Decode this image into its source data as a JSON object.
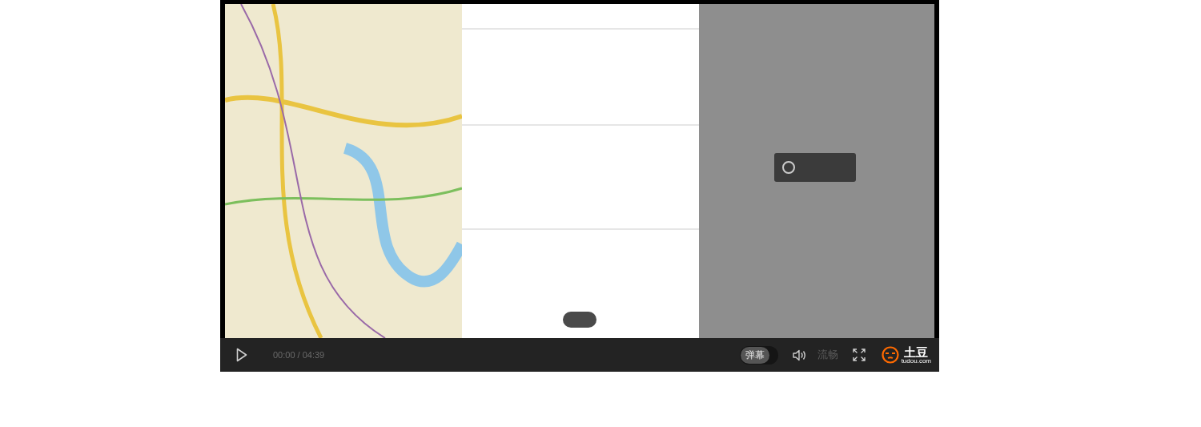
{
  "controls": {
    "time": "00:00 / 04:39",
    "danmaku": {
      "label": "弹幕",
      "on": false
    },
    "quality": "流畅"
  },
  "logo": {
    "name": "土豆",
    "domain": "tudou.com"
  }
}
